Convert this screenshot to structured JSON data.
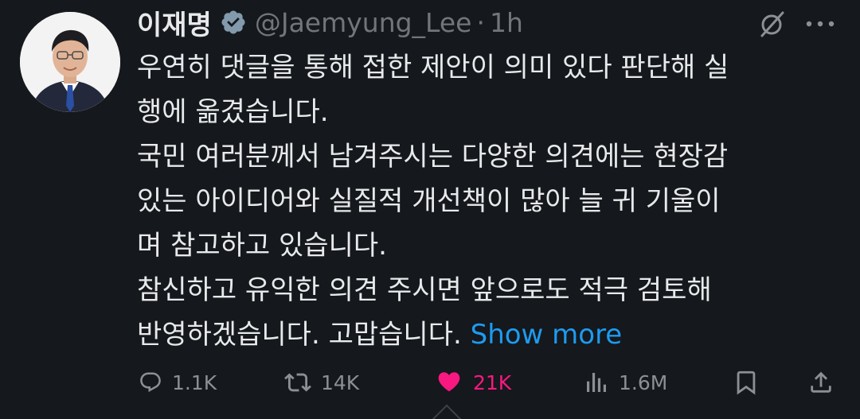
{
  "author": {
    "display_name": "이재명",
    "handle": "@Jaemyung_Lee",
    "separator": "·",
    "time": "1h",
    "verified_icon": "verified-badge-icon"
  },
  "tweet": {
    "lines": [
      "우연히 댓글을 통해 접한 제안이 의미 있다 판단해 실",
      "행에 옮겼습니다.",
      "국민 여러분께서 남겨주시는 다양한 의견에는 현장감",
      "있는 아이디어와 실질적 개선책이 많아 늘 귀 기울이",
      "며 참고하고 있습니다.",
      "참신하고 유익한 의견 주시면 앞으로도 적극 검토해",
      "반영하겠습니다. 고맙습니다."
    ],
    "show_more": "Show more"
  },
  "actions": {
    "reply": "1.1K",
    "retweet": "14K",
    "like": "21K",
    "views": "1.6M"
  },
  "colors": {
    "background": "#15181c",
    "text": "#e7e9ea",
    "muted": "#71767b",
    "link": "#1d9bf0",
    "like": "#f91880"
  }
}
